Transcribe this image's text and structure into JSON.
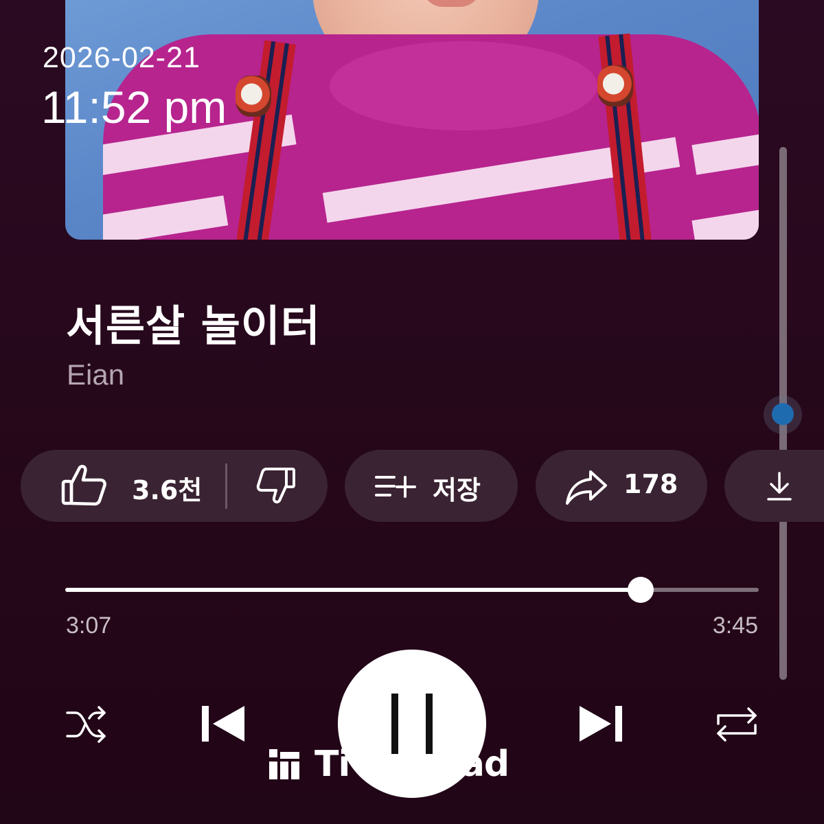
{
  "overlay": {
    "date": "2026-02-21",
    "time": "11:52 pm"
  },
  "song": {
    "title": "서른살 놀이터",
    "artist": "Eian"
  },
  "actions": {
    "like_count": "3.6천",
    "save_label": "저장",
    "share_count": "178"
  },
  "player": {
    "elapsed": "3:07",
    "duration": "3:45",
    "progress_fraction": 0.83,
    "state": "playing"
  },
  "icons": {
    "like": "thumbs-up-icon",
    "dislike": "thumbs-down-icon",
    "save": "playlist-add-icon",
    "share": "share-arrow-icon",
    "download": "download-icon",
    "shuffle": "shuffle-icon",
    "previous": "skip-previous-icon",
    "pause": "pause-icon",
    "next": "skip-next-icon",
    "repeat": "repeat-icon"
  },
  "watermark": {
    "text": "Ti      read"
  },
  "colors": {
    "background": "#26081f",
    "chip": "#3a2333",
    "scroll_thumb": "#1f6bb0",
    "muted_text": "#b4a7b1"
  }
}
